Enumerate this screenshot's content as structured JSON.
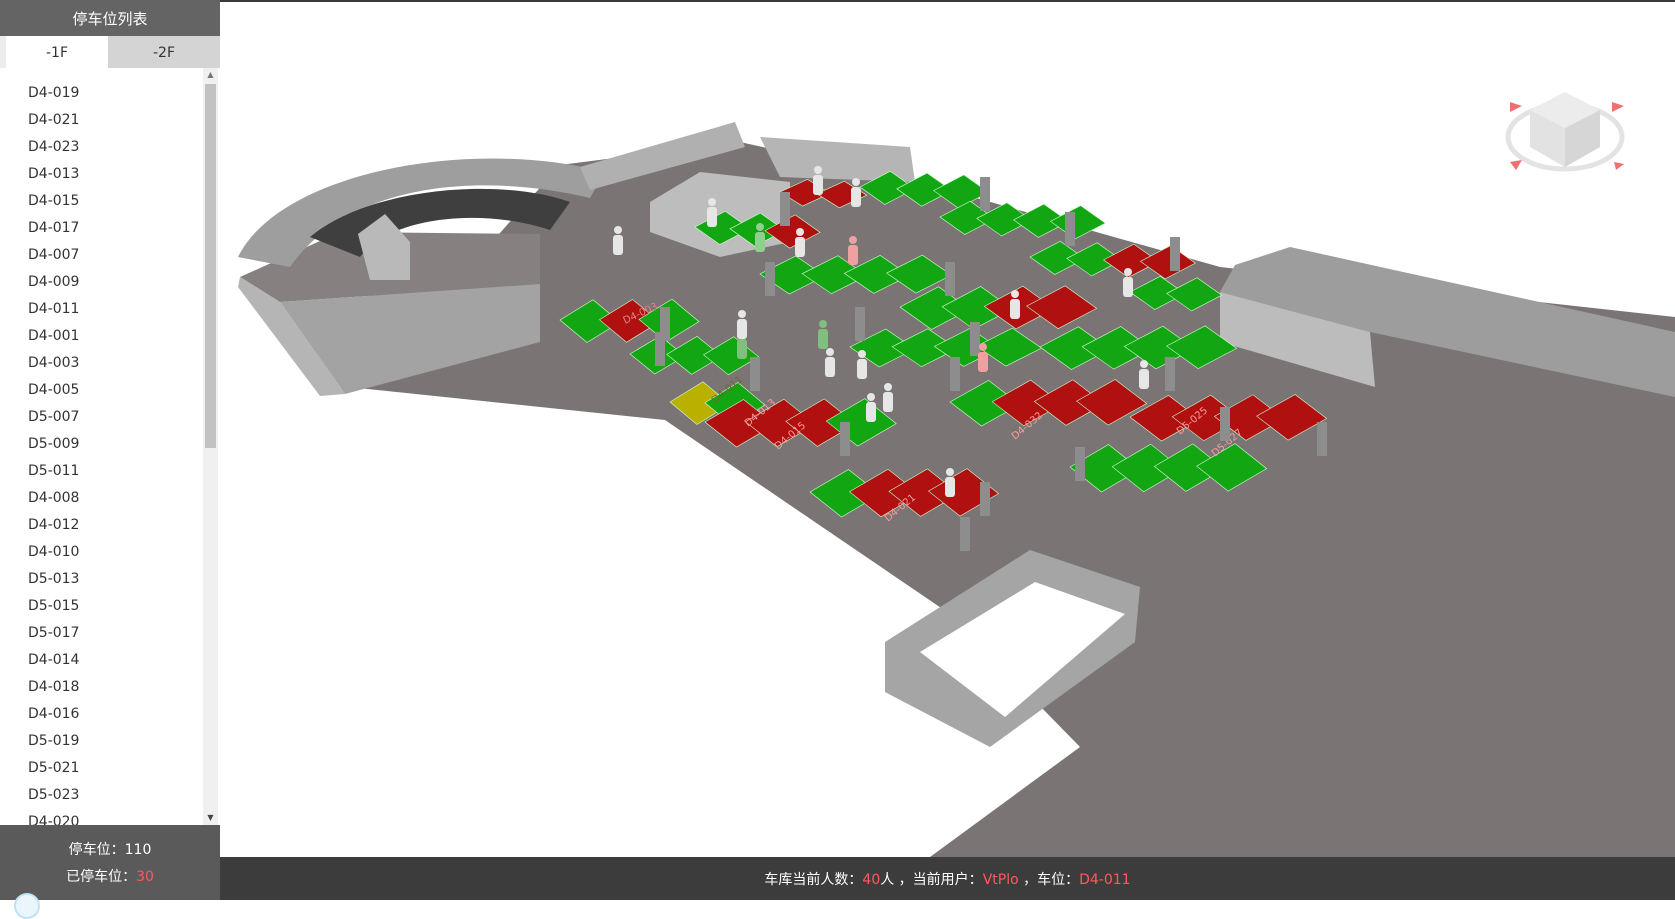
{
  "sidebar": {
    "title": "停车位列表",
    "tabs": [
      {
        "label": "-1F",
        "active": true
      },
      {
        "label": "-2F",
        "active": false
      }
    ],
    "slots": [
      "D4-019",
      "D4-021",
      "D4-023",
      "D4-013",
      "D4-015",
      "D4-017",
      "D4-007",
      "D4-009",
      "D4-011",
      "D4-001",
      "D4-003",
      "D4-005",
      "D5-007",
      "D5-009",
      "D5-011",
      "D4-008",
      "D4-012",
      "D4-010",
      "D5-013",
      "D5-015",
      "D5-017",
      "D4-014",
      "D4-018",
      "D4-016",
      "D5-019",
      "D5-021",
      "D5-023",
      "D4-020"
    ],
    "footer": {
      "total_label": "停车位：",
      "total_value": "110",
      "occupied_label": "已停车位：",
      "occupied_value": "30"
    }
  },
  "scene": {
    "slot_labels": [
      "D4-003",
      "D4-011",
      "D4-013",
      "D4-015",
      "D4-021",
      "D4-032",
      "D5-025",
      "D5-027"
    ],
    "colors": {
      "free": "#13a613",
      "occupied": "#b01010",
      "selected": "#b9b000",
      "floor": "#7b7474",
      "wall": "#a9a9a9"
    }
  },
  "status": {
    "people_label": "车库当前人数：",
    "people_value": "40",
    "people_unit": "人",
    "user_label": " ，当前用户：",
    "user_value": "VtPlo",
    "slot_label": " ，车位：",
    "slot_value": "D4-011"
  }
}
